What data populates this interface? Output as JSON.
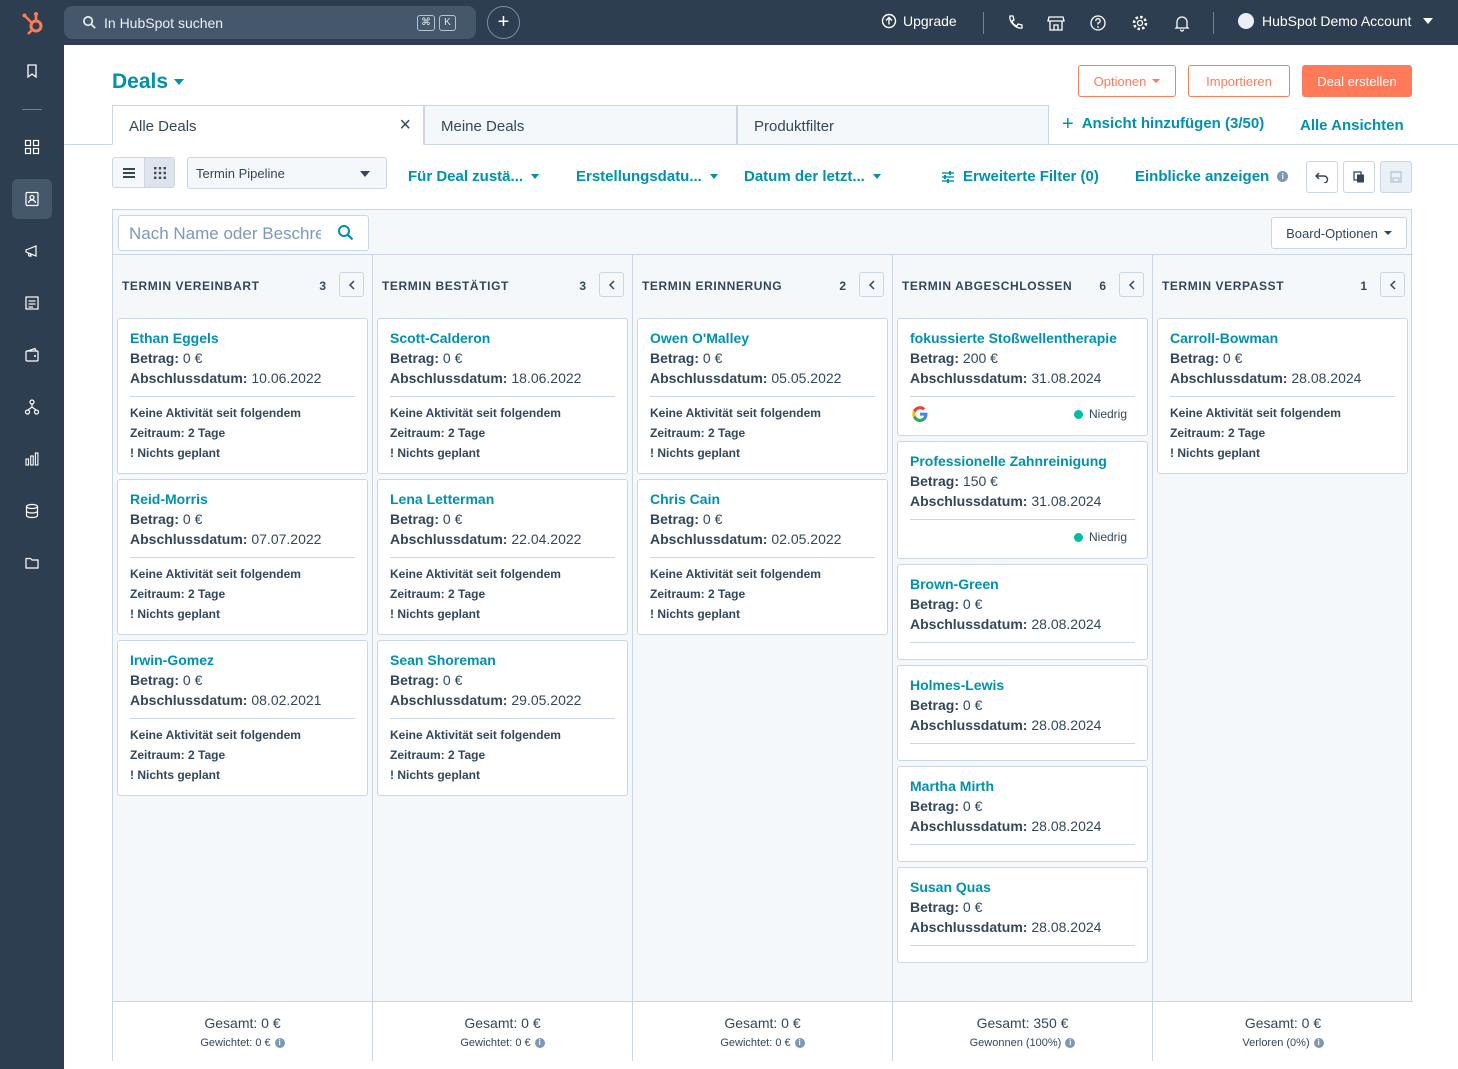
{
  "topbar": {
    "search_placeholder": "In HubSpot suchen",
    "kbd_cmd": "⌘",
    "kbd_k": "K",
    "upgrade_label": "Upgrade",
    "account_name": "HubSpot Demo Account"
  },
  "header": {
    "title": "Deals",
    "options_label": "Optionen",
    "import_label": "Importieren",
    "create_label": "Deal erstellen"
  },
  "tabs": [
    {
      "label": "Alle Deals"
    },
    {
      "label": "Meine Deals"
    },
    {
      "label": "Produktfilter"
    }
  ],
  "tab_links": {
    "add_view": "Ansicht hinzufügen (3/50)",
    "all_views": "Alle Ansichten"
  },
  "filters": {
    "pipeline": "Termin Pipeline",
    "owner": "Für Deal zustä...",
    "created": "Erstellungsdatu...",
    "last_activity": "Datum der letzt...",
    "advanced": "Erweiterte Filter (0)",
    "insights": "Einblicke anzeigen"
  },
  "board": {
    "search_placeholder": "Nach Name oder Beschreibung suchen",
    "options_label": "Board-Optionen",
    "labels": {
      "amount": "Betrag:",
      "close_date": "Abschlussdatum:",
      "activity_1": "Keine Aktivität seit folgendem",
      "activity_2": "Zeitraum: 2 Tage",
      "nothing": "! Nichts geplant",
      "priority": "Niedrig"
    },
    "columns": [
      {
        "title": "TERMIN VEREINBART",
        "count": "3",
        "total": "Gesamt: 0 €",
        "sub": "Gewichtet: 0 €",
        "cards": [
          {
            "name": "Ethan Eggels",
            "amount": "0 €",
            "date": "10.06.2022"
          },
          {
            "name": "Reid-Morris",
            "amount": "0 €",
            "date": "07.07.2022"
          },
          {
            "name": "Irwin-Gomez",
            "amount": "0 €",
            "date": "08.02.2021"
          }
        ]
      },
      {
        "title": "TERMIN BESTÄTIGT",
        "count": "3",
        "total": "Gesamt: 0 €",
        "sub": "Gewichtet: 0 €",
        "cards": [
          {
            "name": "Scott-Calderon",
            "amount": "0 €",
            "date": "18.06.2022"
          },
          {
            "name": "Lena Letterman",
            "amount": "0 €",
            "date": "22.04.2022"
          },
          {
            "name": "Sean Shoreman",
            "amount": "0 €",
            "date": "29.05.2022"
          }
        ]
      },
      {
        "title": "TERMIN ERINNERUNG",
        "count": "2",
        "total": "Gesamt: 0 €",
        "sub": "Gewichtet: 0 €",
        "cards": [
          {
            "name": "Owen O'Malley",
            "amount": "0 €",
            "date": "05.05.2022"
          },
          {
            "name": "Chris Cain",
            "amount": "0 €",
            "date": "02.05.2022"
          }
        ]
      },
      {
        "title": "TERMIN ABGESCHLOSSEN",
        "count": "6",
        "total": "Gesamt: 350 €",
        "sub": "Gewonnen (100%)",
        "cards": [
          {
            "name": "fokussierte Stoßwellentherapie",
            "amount": "200 €",
            "date": "31.08.2024"
          },
          {
            "name": "Professionelle Zahnreinigung",
            "amount": "150 €",
            "date": "31.08.2024"
          },
          {
            "name": "Brown-Green",
            "amount": "0 €",
            "date": "28.08.2024"
          },
          {
            "name": "Holmes-Lewis",
            "amount": "0 €",
            "date": "28.08.2024"
          },
          {
            "name": "Martha Mirth",
            "amount": "0 €",
            "date": "28.08.2024"
          },
          {
            "name": "Susan Quas",
            "amount": "0 €",
            "date": "28.08.2024"
          }
        ]
      },
      {
        "title": "TERMIN VERPASST",
        "count": "1",
        "total": "Gesamt: 0 €",
        "sub": "Verloren (0%)",
        "cards": [
          {
            "name": "Carroll-Bowman",
            "amount": "0 €",
            "date": "28.08.2024"
          }
        ]
      }
    ]
  }
}
